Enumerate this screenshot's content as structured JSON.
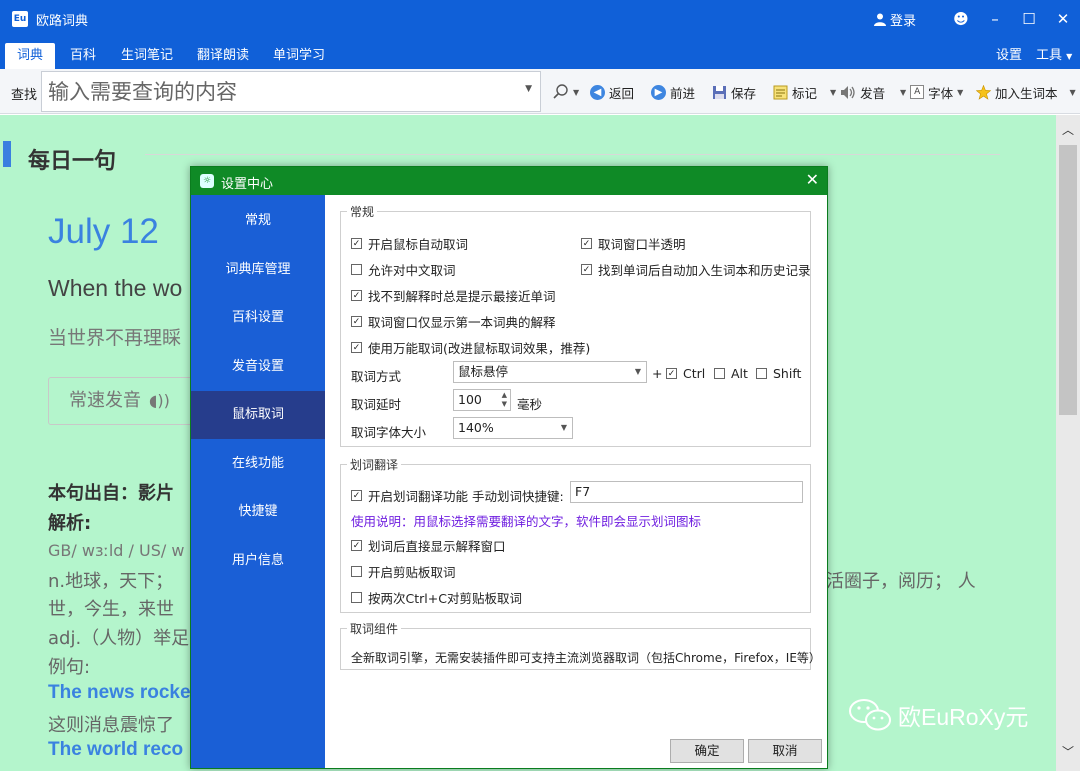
{
  "app": {
    "title": "欧路词典",
    "login": "登录"
  },
  "menu": {
    "tabs": [
      "词典",
      "百科",
      "生词笔记",
      "翻译朗读",
      "单词学习"
    ],
    "settings": "设置",
    "tools": "工具"
  },
  "toolbar": {
    "find_label": "查找",
    "search_placeholder": "输入需要查询的内容",
    "back": "返回",
    "forward": "前进",
    "save": "保存",
    "mark": "标记",
    "pronounce": "发音",
    "font": "字体",
    "add_word": "加入生词本"
  },
  "daily": {
    "heading": "每日一句",
    "date": "July 12",
    "english": "When the wo",
    "chinese": "当世界不再理睬",
    "speak_button": "常速发音",
    "source_label": "本句出自：影片",
    "analysis_label": "解析:",
    "phonetic": "GB/ wɜːld / US/ w",
    "def1": "n.地球，天下；",
    "def1_right": "活圈子，阅历；  人",
    "def2": "世，今生，来世",
    "def3": "adj.（人物）举足",
    "example_label": "例句:",
    "ex1_en": "The news rocke",
    "ex1_cn": "这则消息震惊了",
    "ex2_en": "The world reco"
  },
  "watermark": "欧EuRoXy元",
  "dialog": {
    "title": "设置中心",
    "nav": [
      "常规",
      "词典库管理",
      "百科设置",
      "发音设置",
      "鼠标取词",
      "在线功能",
      "快捷键",
      "用户信息"
    ],
    "active_nav": "鼠标取词",
    "general": {
      "legend": "常规",
      "options": [
        {
          "label": "开启鼠标自动取词",
          "checked": true
        },
        {
          "label": "取词窗口半透明",
          "checked": true
        },
        {
          "label": "允许对中文取词",
          "checked": false
        },
        {
          "label": "找到单词后自动加入生词本和历史记录",
          "checked": true
        },
        {
          "label": "找不到解释时总是提示最接近单词",
          "checked": true
        },
        {
          "label": "取词窗口仅显示第一本词典的解释",
          "checked": true
        },
        {
          "label": "使用万能取词(改进鼠标取词效果，推荐)",
          "checked": true
        }
      ],
      "mode_label": "取词方式",
      "mode_value": "鼠标悬停",
      "plus": "+",
      "ctrl": {
        "label": "Ctrl",
        "checked": true
      },
      "alt": {
        "label": "Alt",
        "checked": false
      },
      "shift": {
        "label": "Shift",
        "checked": false
      },
      "delay_label": "取词延时",
      "delay_value": "100",
      "delay_unit": "毫秒",
      "fontsize_label": "取词字体大小",
      "fontsize_value": "140%"
    },
    "selection": {
      "legend": "划词翻译",
      "enable": {
        "label": "开启划词翻译功能",
        "checked": true
      },
      "hotkey_label": "手动划词快捷键:",
      "hotkey_value": "F7",
      "usage": "使用说明：用鼠标选择需要翻译的文字，软件即会显示划词图标",
      "direct": {
        "label": "划词后直接显示解释窗口",
        "checked": true
      },
      "clipboard": {
        "label": "开启剪贴板取词",
        "checked": false
      },
      "ctrlc": {
        "label": "按两次Ctrl+C对剪贴板取词",
        "checked": false
      }
    },
    "component": {
      "legend": "取词组件",
      "text": "全新取词引擎，无需安装插件即可支持主流浏览器取词（包括Chrome，Firefox，IE等）"
    },
    "ok": "确定",
    "cancel": "取消"
  }
}
